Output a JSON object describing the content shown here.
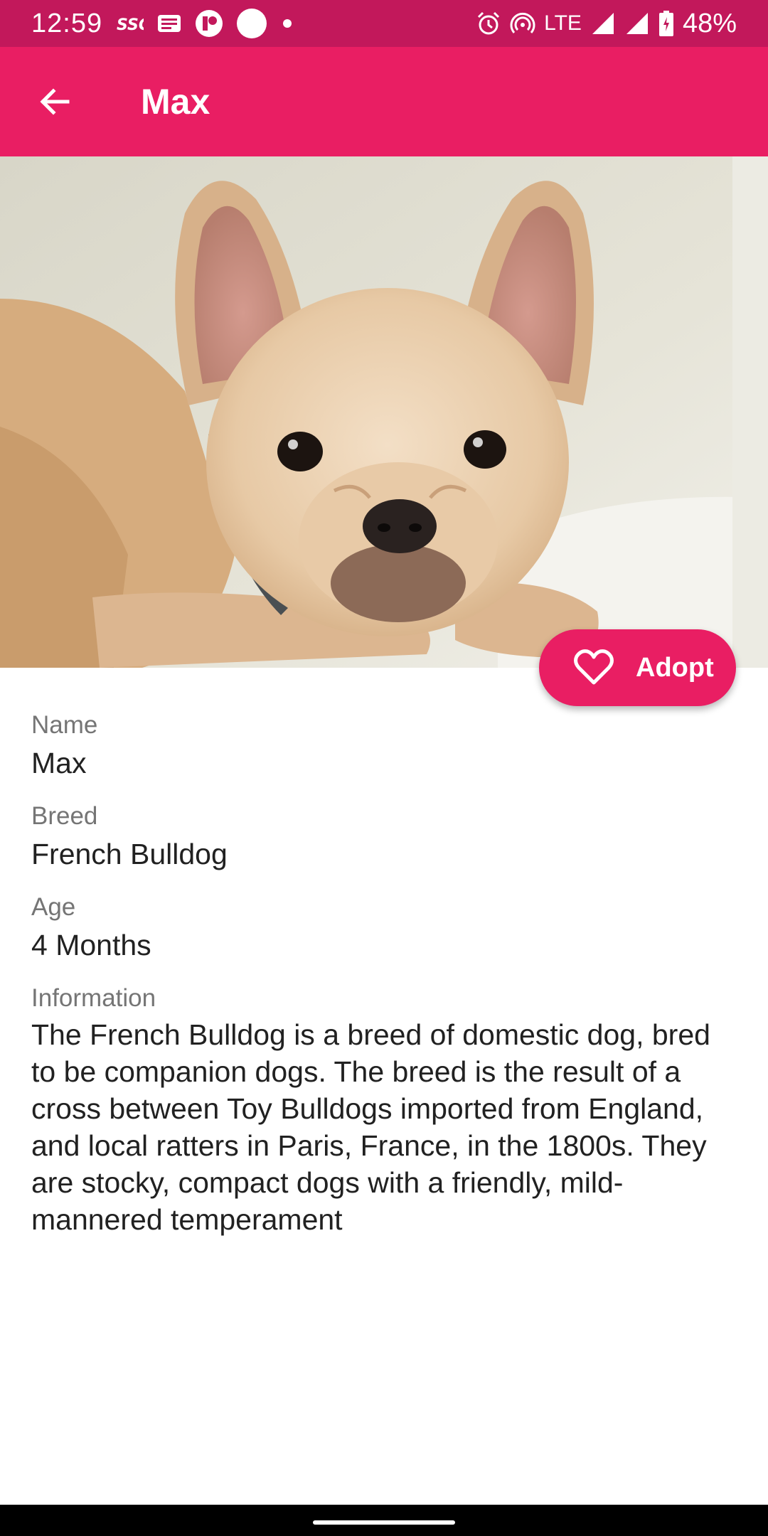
{
  "status_bar": {
    "time": "12:59",
    "network": "LTE",
    "battery": "48%",
    "left_icons": [
      "5g-icon",
      "news-icon",
      "app-icon",
      "circle-icon",
      "dot-icon"
    ],
    "right_icons": [
      "alarm-icon",
      "hotspot-icon",
      "signal-icon",
      "signal-icon",
      "battery-icon"
    ]
  },
  "app_bar": {
    "title": "Max",
    "back_icon": "arrow-back-icon"
  },
  "hero": {
    "icon": "dog-photo"
  },
  "adopt_button": {
    "label": "Adopt",
    "icon": "heart-outline-icon"
  },
  "details": {
    "name_label": "Name",
    "name_value": "Max",
    "breed_label": "Breed",
    "breed_value": "French Bulldog",
    "age_label": "Age",
    "age_value": "4 Months",
    "info_label": "Information",
    "info_value": "The French Bulldog is a breed of domestic dog, bred to be companion dogs. The breed is the result of a cross between Toy Bulldogs imported from England, and local ratters in Paris, France, in the 1800s. They are stocky, compact dogs with a friendly, mild-mannered temperament"
  },
  "colors": {
    "status_bar": "#c2185b",
    "primary": "#e91e63",
    "label_text": "#757575",
    "body_text": "#212121"
  }
}
